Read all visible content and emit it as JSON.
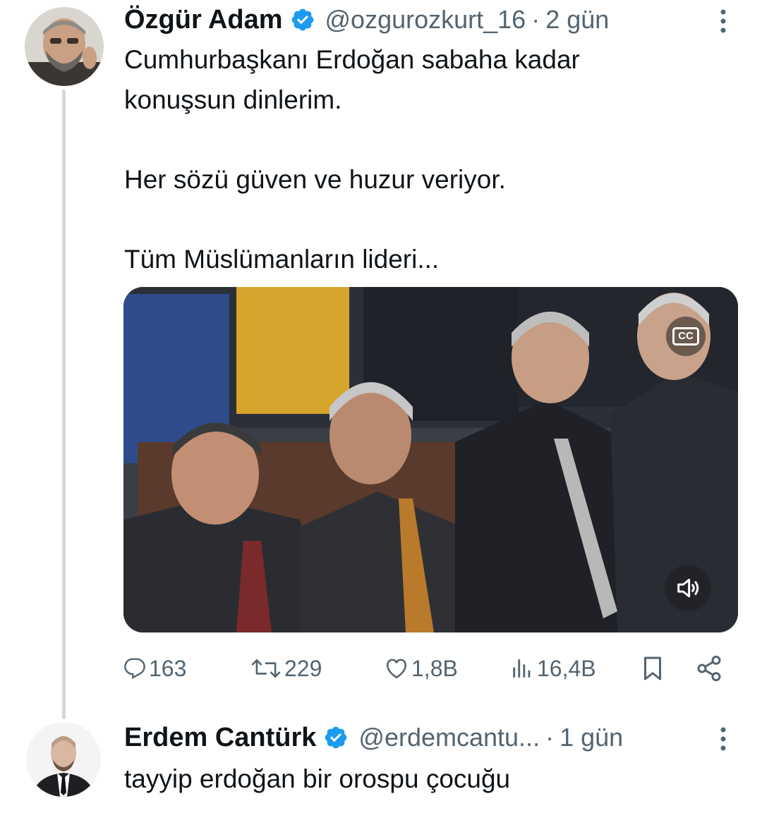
{
  "tweet": {
    "author": {
      "name": "Özgür Adam",
      "handle": "@ozgurozkurt_16",
      "verified": true,
      "avatar_icon": "profile-photo"
    },
    "separator": "·",
    "time": "2 gün",
    "text_lines": [
      "Cumhurbaşkanı Erdoğan sabaha kadar",
      "konuşsun dinlerim.",
      "Her sözü güven ve huzur veriyor.",
      "Tüm Müslümanların lideri..."
    ],
    "media": {
      "type": "video",
      "captions_label": "CC",
      "volume_icon": "speaker-icon"
    },
    "metrics": {
      "replies": "163",
      "retweets": "229",
      "likes": "1,8B",
      "views": "16,4B"
    }
  },
  "reply": {
    "author": {
      "name": "Erdem Cantürk",
      "handle": "@erdemcantu...",
      "verified": true,
      "avatar_icon": "profile-photo"
    },
    "separator": "·",
    "time": "1 gün",
    "text": "tayyip erdoğan bir orospu çocuğu"
  },
  "colors": {
    "text": "#0f1419",
    "secondary": "#536471",
    "verified": "#1d9bf0",
    "thread_line": "#cfd9de"
  }
}
